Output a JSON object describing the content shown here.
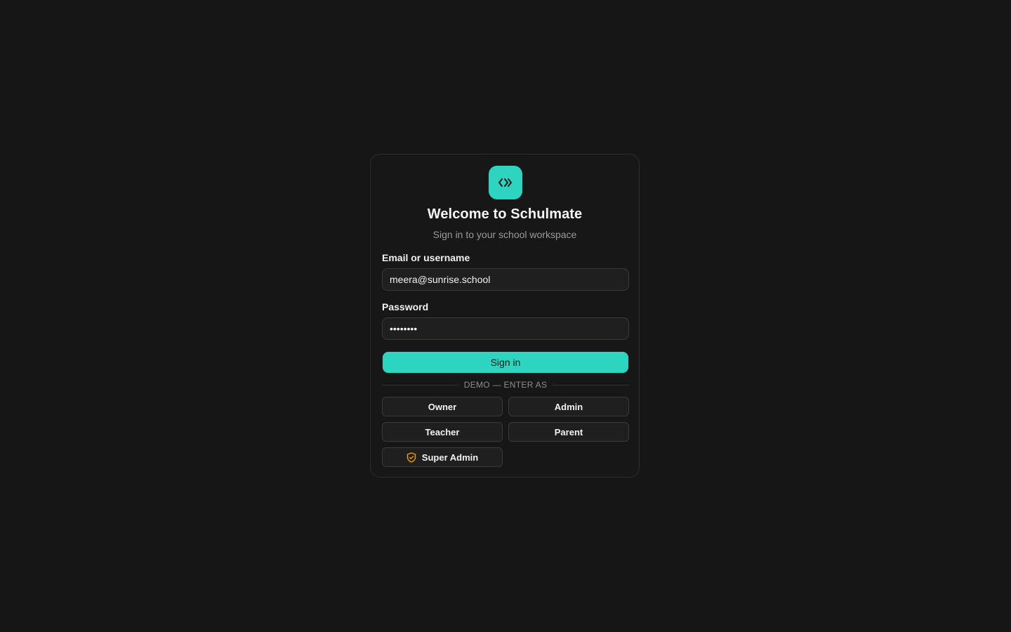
{
  "brand": {
    "logo_icon": "code-chevrons-icon",
    "accent": "#2dd4bf"
  },
  "header": {
    "title": "Welcome to Schulmate",
    "subtitle": "Sign in to your school workspace"
  },
  "form": {
    "email_label": "Email or username",
    "email_value": "meera@sunrise.school",
    "password_label": "Password",
    "password_value": "password",
    "signin_label": "Sign in"
  },
  "demo": {
    "divider_label": "DEMO — ENTER AS",
    "roles": {
      "owner": "Owner",
      "admin": "Admin",
      "teacher": "Teacher",
      "parent": "Parent",
      "super_admin": "Super Admin"
    },
    "super_admin_icon": "shield-check-icon",
    "super_admin_icon_color": "#f59e0b"
  }
}
